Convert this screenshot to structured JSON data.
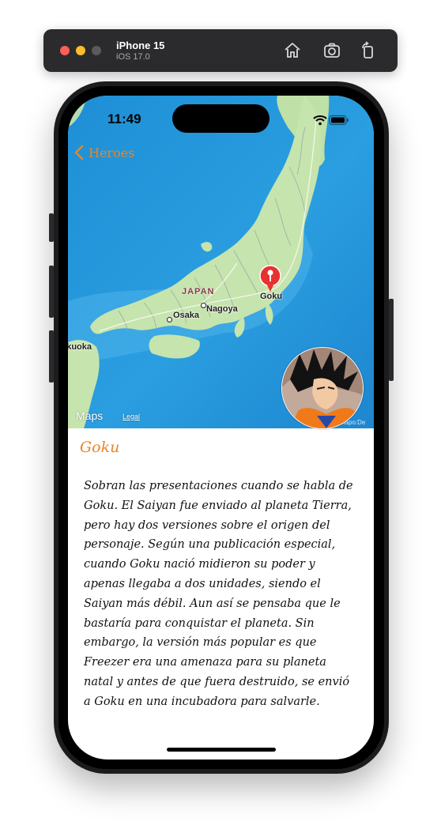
{
  "simulator": {
    "device_name": "iPhone 15",
    "os_version": "iOS 17.0",
    "toolbar_icons": [
      "home-icon",
      "screenshot-icon",
      "rotate-icon"
    ]
  },
  "status_bar": {
    "time": "11:49"
  },
  "navigation": {
    "back_label": "Heroes",
    "accent_color": "#e8862a"
  },
  "map": {
    "region_label": "JAPAN",
    "cities": [
      "Osaka",
      "Nagoya",
      "Fukuoka"
    ],
    "pin_label": "Goku",
    "provider_label": "Maps",
    "legal_label": "Legal",
    "attribution_label": "©mapo:De"
  },
  "hero": {
    "name": "Goku",
    "description": "Sobran las presentaciones cuando se habla de Goku. El Saiyan fue enviado al planeta Tierra, pero hay dos versiones sobre el origen del personaje. Según una publicación especial, cuando Goku nació midieron su poder y apenas llegaba a dos unidades, siendo el Saiyan más débil. Aun así se pensaba que le bastaría para conquistar el planeta. Sin embargo, la versión más popular es que Freezer era una amenaza para su planeta natal y antes de que fuera destruido, se envió a Goku en una incubadora para salvarle."
  }
}
